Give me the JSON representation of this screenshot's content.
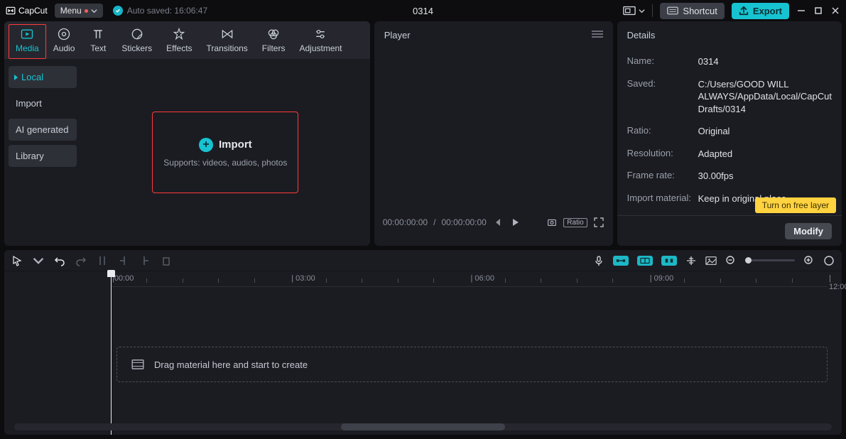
{
  "topbar": {
    "app_name": "CapCut",
    "menu_label": "Menu",
    "autosaved_label": "Auto saved: 16:06:47",
    "project_title": "0314",
    "shortcut_label": "Shortcut",
    "export_label": "Export"
  },
  "tool_tabs": {
    "media": "Media",
    "audio": "Audio",
    "text": "Text",
    "stickers": "Stickers",
    "effects": "Effects",
    "transitions": "Transitions",
    "filters": "Filters",
    "adjustment": "Adjustment"
  },
  "media_sidebar": {
    "local": "Local",
    "import": "Import",
    "ai_generated": "AI generated",
    "library": "Library"
  },
  "import_box": {
    "title": "Import",
    "subtitle": "Supports: videos, audios, photos"
  },
  "player": {
    "header": "Player",
    "time_current": "00:00:00:00",
    "time_total": "00:00:00:00",
    "ratio_label": "Ratio"
  },
  "details": {
    "header": "Details",
    "name_label": "Name:",
    "name_value": "0314",
    "saved_label": "Saved:",
    "saved_value": "C:/Users/GOOD WILL ALWAYS/AppData/Local/CapCut Drafts/0314",
    "ratio_label": "Ratio:",
    "ratio_value": "Original",
    "resolution_label": "Resolution:",
    "resolution_value": "Adapted",
    "framerate_label": "Frame rate:",
    "framerate_value": "30.00fps",
    "import_material_label": "Import material:",
    "import_material_value": "Keep in original place",
    "modify_label": "Modify",
    "tooltip": "Turn on free layer"
  },
  "timeline": {
    "ruler_labels": [
      "|00:00",
      "| 03:00",
      "| 06:00",
      "| 09:00",
      "| 12:00"
    ],
    "drop_hint": "Drag material here and start to create"
  }
}
